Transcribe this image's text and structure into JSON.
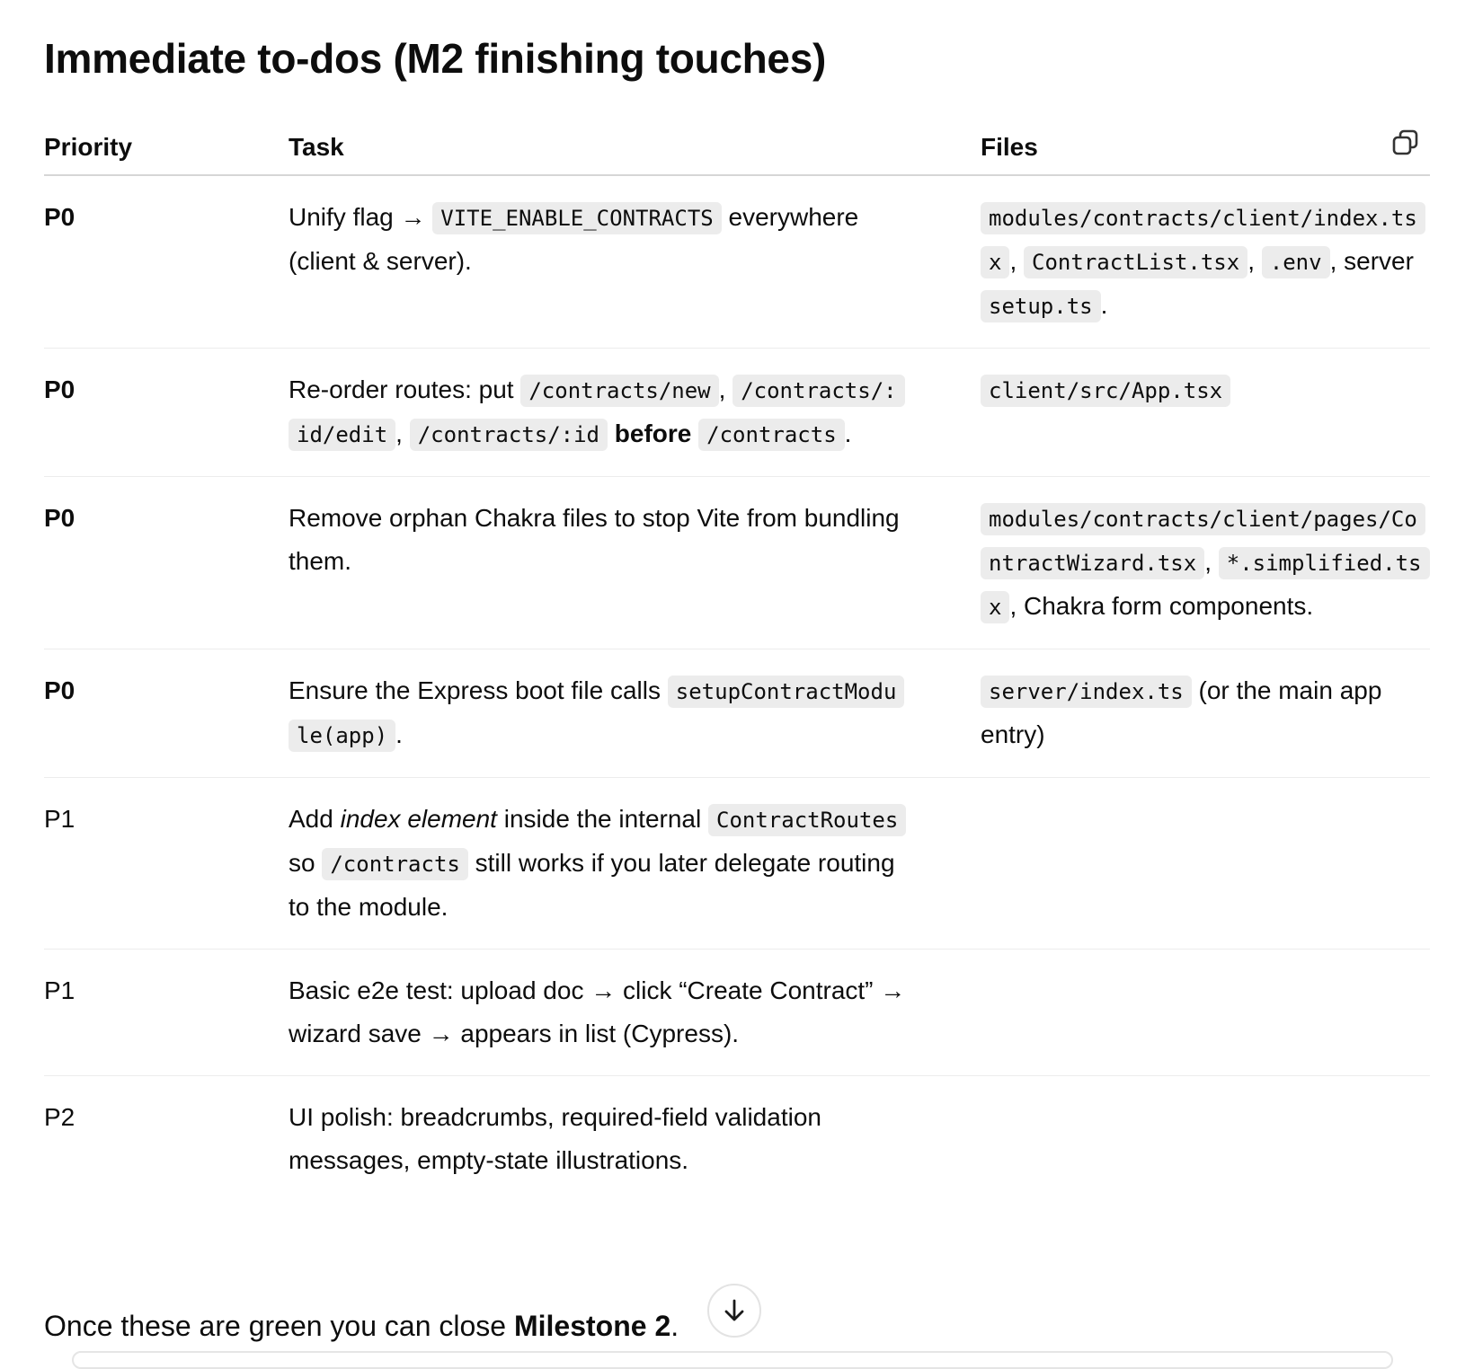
{
  "heading": "Immediate to-dos (M2 finishing touches)",
  "table": {
    "columns": [
      "Priority",
      "Task",
      "Files"
    ],
    "copy_icon": "copy-icon",
    "rows": [
      {
        "priority": "P0",
        "task": [
          "Unify flag → ",
          {
            "code": "VITE_ENABLE_CONTRACTS"
          },
          " everywhere (client & server)."
        ],
        "files": [
          {
            "code": "modules/contracts/client/index.tsx"
          },
          ", ",
          {
            "code": "ContractList.tsx"
          },
          ", ",
          {
            "code": ".env"
          },
          ", server ",
          {
            "code": "setup.ts"
          },
          "."
        ]
      },
      {
        "priority": "P0",
        "task": [
          "Re-order routes: put ",
          {
            "code": "/contracts/new"
          },
          ", ",
          {
            "code": "/contracts/:id/edit"
          },
          ", ",
          {
            "code": "/contracts/:id"
          },
          " ",
          {
            "b": "before"
          },
          " ",
          {
            "code": "/contracts"
          },
          "."
        ],
        "files": [
          {
            "code": "client/src/App.tsx"
          }
        ]
      },
      {
        "priority": "P0",
        "task": [
          "Remove orphan Chakra files to stop Vite from bundling them."
        ],
        "files": [
          {
            "code": "modules/contracts/client/pages/ContractWizard.tsx"
          },
          ", ",
          {
            "code": "*.simplified.tsx"
          },
          ", Chakra form components."
        ]
      },
      {
        "priority": "P0",
        "task": [
          "Ensure the Express boot file calls ",
          {
            "code": "setupContractModule(app)"
          },
          "."
        ],
        "files": [
          {
            "code": "server/index.ts"
          },
          " (or the main app entry)"
        ]
      },
      {
        "priority": "P1",
        "task": [
          "Add ",
          {
            "i": "index element"
          },
          " inside the internal ",
          {
            "code": "ContractRoutes"
          },
          " so ",
          {
            "code": "/contracts"
          },
          " still works if you later delegate routing to the module."
        ],
        "files": []
      },
      {
        "priority": "P1",
        "task": [
          "Basic e2e test: upload doc → click “Create Contract” → wizard save → appears in list (Cypress)."
        ],
        "files": []
      },
      {
        "priority": "P2",
        "task": [
          "UI polish: breadcrumbs, required-field validation messages, empty-state illustrations."
        ],
        "files": []
      }
    ]
  },
  "footer": {
    "text_before": "Once these are green you can close ",
    "bold": "Milestone 2",
    "text_after": "."
  },
  "scroll_icon": "arrow-down-icon"
}
